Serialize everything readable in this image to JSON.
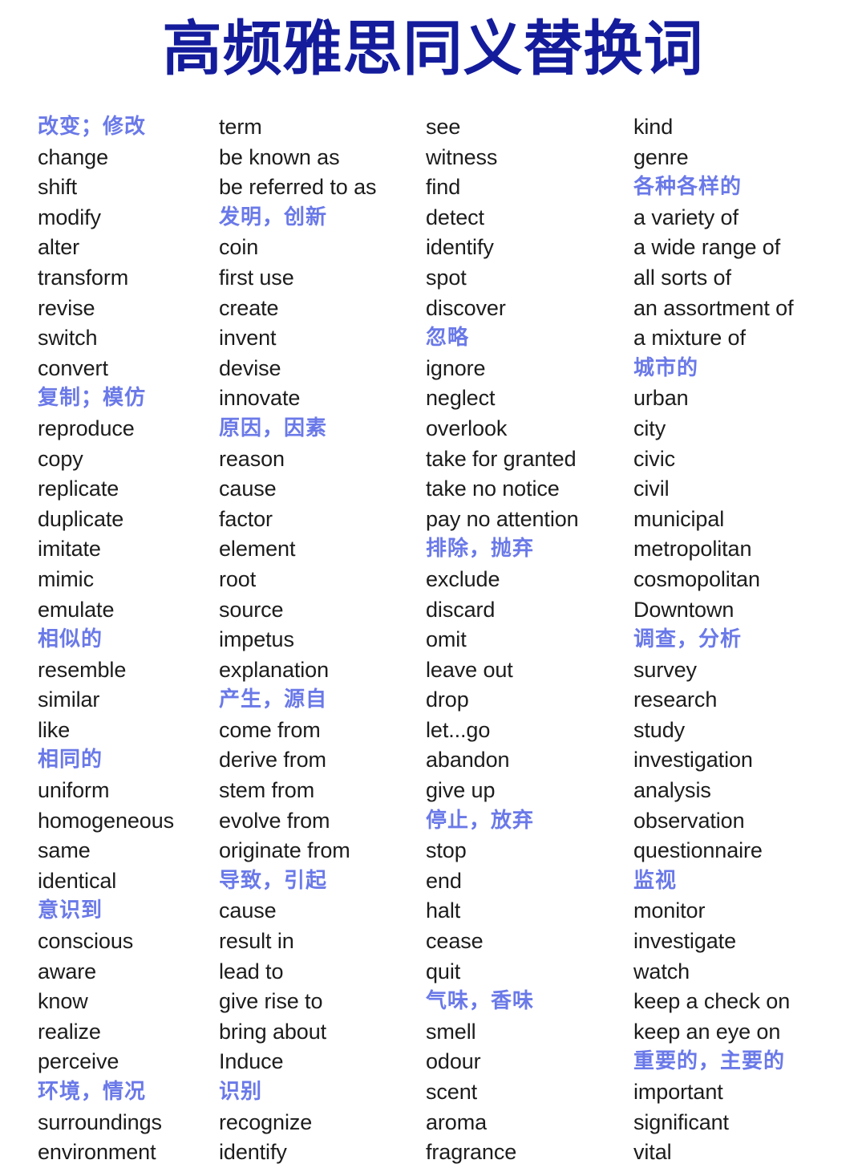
{
  "header": {
    "title": "高频雅思同义替换词",
    "title_color": "#141C9C"
  },
  "style": {
    "heading_color": "#6A79E8",
    "word_color": "#1C1C1C",
    "background_color": "#FFFFFF"
  },
  "columns": [
    {
      "id": "column-1",
      "entries": [
        {
          "text": "改变；修改",
          "lang": "zh"
        },
        {
          "text": "change",
          "lang": "en"
        },
        {
          "text": "shift",
          "lang": "en"
        },
        {
          "text": "modify",
          "lang": "en"
        },
        {
          "text": "alter",
          "lang": "en"
        },
        {
          "text": "transform",
          "lang": "en"
        },
        {
          "text": "revise",
          "lang": "en"
        },
        {
          "text": "switch",
          "lang": "en"
        },
        {
          "text": "convert",
          "lang": "en"
        },
        {
          "text": "复制；模仿",
          "lang": "zh"
        },
        {
          "text": "reproduce",
          "lang": "en"
        },
        {
          "text": "copy",
          "lang": "en"
        },
        {
          "text": "replicate",
          "lang": "en"
        },
        {
          "text": "duplicate",
          "lang": "en"
        },
        {
          "text": "imitate",
          "lang": "en"
        },
        {
          "text": "mimic",
          "lang": "en"
        },
        {
          "text": "emulate",
          "lang": "en"
        },
        {
          "text": "相似的",
          "lang": "zh"
        },
        {
          "text": "resemble",
          "lang": "en"
        },
        {
          "text": "similar",
          "lang": "en"
        },
        {
          "text": "like",
          "lang": "en"
        },
        {
          "text": "相同的",
          "lang": "zh"
        },
        {
          "text": "uniform",
          "lang": "en"
        },
        {
          "text": "homogeneous",
          "lang": "en"
        },
        {
          "text": "same",
          "lang": "en"
        },
        {
          "text": "identical",
          "lang": "en"
        },
        {
          "text": "意识到",
          "lang": "zh"
        },
        {
          "text": "conscious",
          "lang": "en"
        },
        {
          "text": "aware",
          "lang": "en"
        },
        {
          "text": "know",
          "lang": "en"
        },
        {
          "text": "realize",
          "lang": "en"
        },
        {
          "text": "perceive",
          "lang": "en"
        },
        {
          "text": "环境，情况",
          "lang": "zh"
        },
        {
          "text": "surroundings",
          "lang": "en"
        },
        {
          "text": "environment",
          "lang": "en"
        }
      ]
    },
    {
      "id": "column-2",
      "entries": [
        {
          "text": "term",
          "lang": "en"
        },
        {
          "text": "be known as",
          "lang": "en"
        },
        {
          "text": "be referred to as",
          "lang": "en"
        },
        {
          "text": "发明，创新",
          "lang": "zh"
        },
        {
          "text": "coin",
          "lang": "en"
        },
        {
          "text": "first use",
          "lang": "en"
        },
        {
          "text": "create",
          "lang": "en"
        },
        {
          "text": "invent",
          "lang": "en"
        },
        {
          "text": "devise",
          "lang": "en"
        },
        {
          "text": "innovate",
          "lang": "en"
        },
        {
          "text": "原因，因素",
          "lang": "zh"
        },
        {
          "text": "reason",
          "lang": "en"
        },
        {
          "text": "cause",
          "lang": "en"
        },
        {
          "text": "factor",
          "lang": "en"
        },
        {
          "text": "element",
          "lang": "en"
        },
        {
          "text": "root",
          "lang": "en"
        },
        {
          "text": "source",
          "lang": "en"
        },
        {
          "text": "impetus",
          "lang": "en"
        },
        {
          "text": "explanation",
          "lang": "en"
        },
        {
          "text": "产生，源自",
          "lang": "zh"
        },
        {
          "text": "come from",
          "lang": "en"
        },
        {
          "text": "derive from",
          "lang": "en"
        },
        {
          "text": "stem from",
          "lang": "en"
        },
        {
          "text": "evolve from",
          "lang": "en"
        },
        {
          "text": "originate from",
          "lang": "en"
        },
        {
          "text": "导致，引起",
          "lang": "zh"
        },
        {
          "text": "cause",
          "lang": "en"
        },
        {
          "text": "result in",
          "lang": "en"
        },
        {
          "text": "lead to",
          "lang": "en"
        },
        {
          "text": "give rise to",
          "lang": "en"
        },
        {
          "text": "bring about",
          "lang": "en"
        },
        {
          "text": "Induce",
          "lang": "en"
        },
        {
          "text": "识别",
          "lang": "zh"
        },
        {
          "text": "recognize",
          "lang": "en"
        },
        {
          "text": "identify",
          "lang": "en"
        }
      ]
    },
    {
      "id": "column-3",
      "entries": [
        {
          "text": "see",
          "lang": "en"
        },
        {
          "text": "witness",
          "lang": "en"
        },
        {
          "text": "find",
          "lang": "en"
        },
        {
          "text": "detect",
          "lang": "en"
        },
        {
          "text": "identify",
          "lang": "en"
        },
        {
          "text": "spot",
          "lang": "en"
        },
        {
          "text": "discover",
          "lang": "en"
        },
        {
          "text": "忽略",
          "lang": "zh"
        },
        {
          "text": "ignore",
          "lang": "en"
        },
        {
          "text": "neglect",
          "lang": "en"
        },
        {
          "text": "overlook",
          "lang": "en"
        },
        {
          "text": "take for granted",
          "lang": "en"
        },
        {
          "text": "take no notice",
          "lang": "en"
        },
        {
          "text": "pay no attention",
          "lang": "en"
        },
        {
          "text": "排除，抛弃",
          "lang": "zh"
        },
        {
          "text": "exclude",
          "lang": "en"
        },
        {
          "text": "discard",
          "lang": "en"
        },
        {
          "text": "omit",
          "lang": "en"
        },
        {
          "text": "leave out",
          "lang": "en"
        },
        {
          "text": "drop",
          "lang": "en"
        },
        {
          "text": "let...go",
          "lang": "en"
        },
        {
          "text": "abandon",
          "lang": "en"
        },
        {
          "text": "give up",
          "lang": "en"
        },
        {
          "text": "停止，放弃",
          "lang": "zh"
        },
        {
          "text": "stop",
          "lang": "en"
        },
        {
          "text": "end",
          "lang": "en"
        },
        {
          "text": "halt",
          "lang": "en"
        },
        {
          "text": "cease",
          "lang": "en"
        },
        {
          "text": "quit",
          "lang": "en"
        },
        {
          "text": "气味，香味",
          "lang": "zh"
        },
        {
          "text": "smell",
          "lang": "en"
        },
        {
          "text": "odour",
          "lang": "en"
        },
        {
          "text": "scent",
          "lang": "en"
        },
        {
          "text": "aroma",
          "lang": "en"
        },
        {
          "text": "fragrance",
          "lang": "en"
        }
      ]
    },
    {
      "id": "column-4",
      "entries": [
        {
          "text": "kind",
          "lang": "en"
        },
        {
          "text": "genre",
          "lang": "en"
        },
        {
          "text": "各种各样的",
          "lang": "zh"
        },
        {
          "text": "a variety of",
          "lang": "en"
        },
        {
          "text": "a wide range of",
          "lang": "en"
        },
        {
          "text": "all sorts of",
          "lang": "en"
        },
        {
          "text": "an assortment of",
          "lang": "en"
        },
        {
          "text": "a mixture of",
          "lang": "en"
        },
        {
          "text": "城市的",
          "lang": "zh"
        },
        {
          "text": "urban",
          "lang": "en"
        },
        {
          "text": "city",
          "lang": "en"
        },
        {
          "text": "civic",
          "lang": "en"
        },
        {
          "text": "civil",
          "lang": "en"
        },
        {
          "text": "municipal",
          "lang": "en"
        },
        {
          "text": "metropolitan",
          "lang": "en"
        },
        {
          "text": "cosmopolitan",
          "lang": "en"
        },
        {
          "text": "Downtown",
          "lang": "en"
        },
        {
          "text": "调查，分析",
          "lang": "zh"
        },
        {
          "text": "survey",
          "lang": "en"
        },
        {
          "text": "research",
          "lang": "en"
        },
        {
          "text": "study",
          "lang": "en"
        },
        {
          "text": "investigation",
          "lang": "en"
        },
        {
          "text": "analysis",
          "lang": "en"
        },
        {
          "text": "observation",
          "lang": "en"
        },
        {
          "text": "questionnaire",
          "lang": "en"
        },
        {
          "text": "监视",
          "lang": "zh"
        },
        {
          "text": "monitor",
          "lang": "en"
        },
        {
          "text": "investigate",
          "lang": "en"
        },
        {
          "text": "watch",
          "lang": "en"
        },
        {
          "text": "keep a check on",
          "lang": "en"
        },
        {
          "text": "keep an eye on",
          "lang": "en"
        },
        {
          "text": "重要的，主要的",
          "lang": "zh"
        },
        {
          "text": "important",
          "lang": "en"
        },
        {
          "text": "significant",
          "lang": "en"
        },
        {
          "text": "vital",
          "lang": "en"
        }
      ]
    }
  ]
}
